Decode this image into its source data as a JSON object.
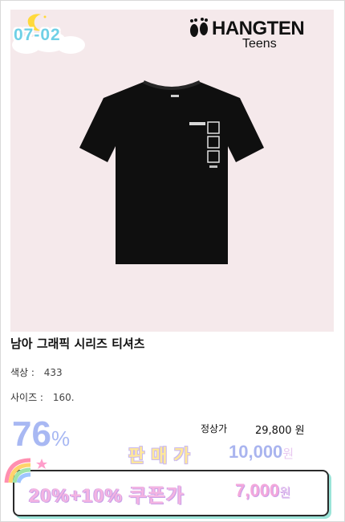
{
  "badge": {
    "date": "07-02"
  },
  "brand": {
    "name": "HANGTEN",
    "sub": "Teens"
  },
  "product": {
    "title": "남아 그래픽 시리즈 티셔츠",
    "color_label": "색상 :",
    "color_value": "433",
    "size_label": "사이즈 :",
    "size_value": "160."
  },
  "pricing": {
    "discount_number": "76",
    "discount_unit": "%",
    "regular_label": "정상가",
    "regular_price": "29,800 원",
    "sale_label": "판매가",
    "sale_price": "10,000",
    "sale_unit": "원",
    "coupon_label": "20%+10% 쿠폰가",
    "coupon_price": "7,000",
    "coupon_unit": "원"
  },
  "colors": {
    "hero_bg": "#f5e9eb",
    "accent_blue": "#a8b8f3",
    "accent_pink": "#f3b4e2",
    "shirt": "#0f0f0f"
  }
}
